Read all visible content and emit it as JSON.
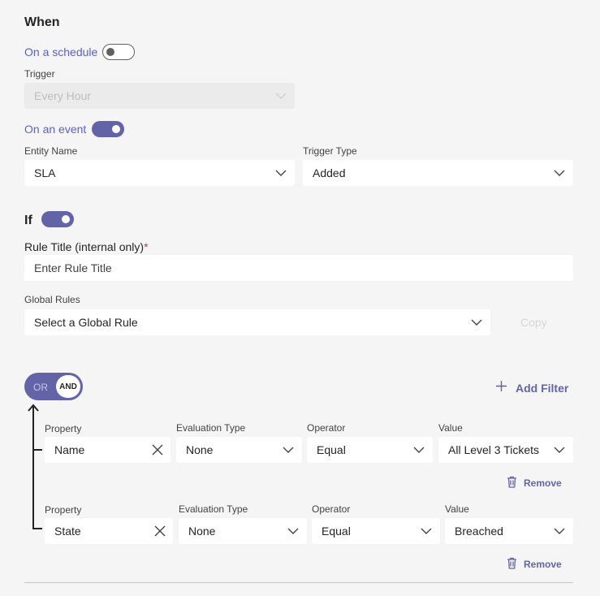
{
  "when": {
    "title": "When",
    "schedule": {
      "label": "On a schedule",
      "enabled": false
    },
    "trigger": {
      "label": "Trigger",
      "value": "Every Hour"
    },
    "event": {
      "label": "On an event",
      "enabled": true
    },
    "entity": {
      "label": "Entity Name",
      "value": "SLA"
    },
    "trigger_type": {
      "label": "Trigger Type",
      "value": "Added"
    }
  },
  "if": {
    "title": "If",
    "enabled": true,
    "rule_title": {
      "label": "Rule Title (internal only)",
      "required_mark": "*",
      "placeholder": "Enter Rule Title"
    },
    "global_rules": {
      "label": "Global Rules",
      "value": "Select a Global Rule",
      "copy_label": "Copy"
    }
  },
  "logic": {
    "or_label": "OR",
    "and_label": "AND",
    "selected": "AND",
    "add_filter_label": "Add Filter"
  },
  "filters": [
    {
      "property_label": "Property",
      "property": "Name",
      "eval_label": "Evaluation Type",
      "eval": "None",
      "operator_label": "Operator",
      "operator": "Equal",
      "value_label": "Value",
      "value": "All Level 3 Tickets",
      "remove_label": "Remove"
    },
    {
      "property_label": "Property",
      "property": "State",
      "eval_label": "Evaluation Type",
      "eval": "None",
      "operator_label": "Operator",
      "operator": "Equal",
      "value_label": "Value",
      "value": "Breached",
      "remove_label": "Remove"
    }
  ],
  "colors": {
    "accent": "#6264a7",
    "link": "#5b5fc7",
    "background": "#f5f5f5",
    "field": "#ffffff",
    "required": "#c4314b"
  }
}
